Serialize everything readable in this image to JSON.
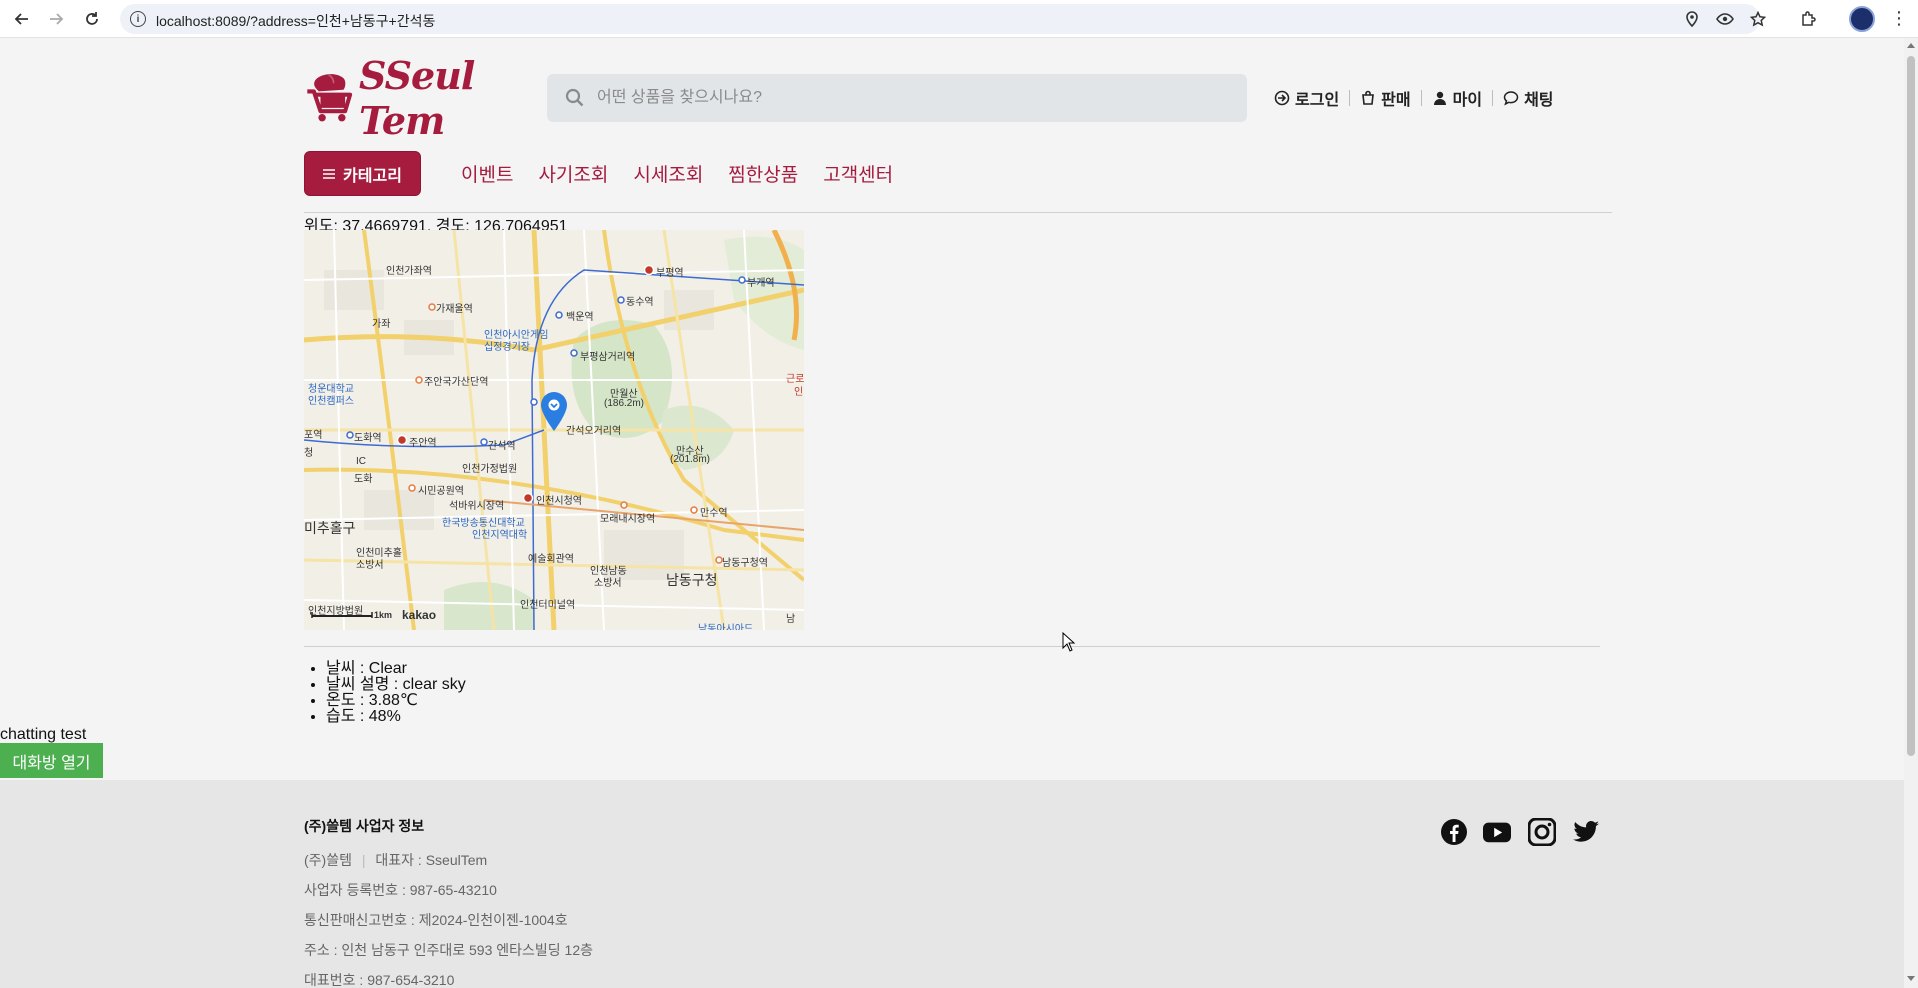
{
  "browser": {
    "url": "localhost:8089/?address=인천+남동구+간석동",
    "icons": {
      "back": "arrow-left-icon",
      "forward": "arrow-right-icon",
      "reload": "reload-icon",
      "info": "info-icon",
      "location": "location-icon",
      "eye": "eye-icon",
      "star": "star-icon",
      "extensions": "puzzle-icon",
      "menu": "kebab-icon"
    }
  },
  "header": {
    "brand": "SSeul Tem",
    "search_placeholder": "어떤 상품을 찾으시나요?",
    "nav": [
      {
        "label": "로그인",
        "icon": "login-icon"
      },
      {
        "label": "판매",
        "icon": "sell-bag-icon"
      },
      {
        "label": "마이",
        "icon": "user-icon"
      },
      {
        "label": "채팅",
        "icon": "chat-icon"
      }
    ],
    "accent_color": "#a51c3e"
  },
  "category": {
    "button_label": "카테고리",
    "links": [
      "이벤트",
      "사기조회",
      "시세조회",
      "찜한상품",
      "고객센터"
    ]
  },
  "location": {
    "text": "위도: 37.4669791, 경도: 126.7064951"
  },
  "map": {
    "labels": {
      "station_incheon_gajwa": "인천가좌역",
      "station_bupyeong": "부평역",
      "station_bugae": "부개역",
      "gajaeul": "가재울역",
      "gajwa": "가좌",
      "baegun": "백운역",
      "dongsu": "동수역",
      "asian_games": "인천아시안게임",
      "asian_games2": "십정경기장",
      "bupyeong_samgeori": "부평삼거리역",
      "geunro": "근로",
      "in": "인",
      "juan_gukga": "주안국가산단역",
      "cheongun": "청운대학교",
      "cheongun2": "인천캠퍼스",
      "manwolsan": "만월산",
      "manwolsan_h": "(186.2m)",
      "dohwa_station": "도화역",
      "juan": "주안역",
      "ganseok": "간석역",
      "ganseok_ogeori": "간석오거리역",
      "mansusan": "만수산",
      "mansusan_h": "(201.8m)",
      "po": "포역",
      "cheong": "청",
      "incheon_family_court": "인천가정법원",
      "ic": "IC",
      "dohwa": "도화",
      "incheon_sicheong": "인천시청역",
      "simin_park": "시민공원역",
      "seokbawi": "석바위시장역",
      "moraenae": "모래내시장역",
      "mansu": "만수역",
      "korea_national_open": "한국방송통신대학교",
      "korea_national_open2": "인천지역대학",
      "michuhol": "미추홀구",
      "incheon_michuhol_fire": "인천미추홀",
      "incheon_michuhol_fire2": "소방서",
      "arts_center": "예술회관역",
      "incheon_namdong_fire": "인천남동",
      "incheon_namdong_fire2": "소방서",
      "namdong_gu": "남동구청",
      "namdong_gu_station": "남동구청역",
      "incheon_district_court": "인천지방법원",
      "incheon_terminal": "인천터미널역",
      "nam": "남",
      "scale": "1km",
      "provider": "kakao",
      "bottom_label": "남동아시아드"
    },
    "marker_icon": "map-pin-icon"
  },
  "weather": {
    "items": [
      "날씨 : Clear",
      "날씨 설명 : clear sky",
      "온도 : 3.88℃",
      "습도 : 48%"
    ]
  },
  "chat": {
    "label": "chatting test",
    "button": "대화방 열기",
    "button_color": "#4caf50"
  },
  "footer": {
    "title": "(주)쓸템 사업자 정보",
    "company": "(주)쓸템",
    "ceo": "대표자 : SseulTem",
    "reg_no": "사업자 등록번호 : 987-65-43210",
    "mail_order": "통신판매신고번호 : 제2024-인천이젠-1004호",
    "address": "주소 : 인천 남동구 인주대로 593 엔타스빌딩 12층",
    "phone": "대표번호 : 987-654-3210",
    "social_icons": [
      "facebook-icon",
      "youtube-icon",
      "instagram-icon",
      "twitter-icon"
    ]
  }
}
